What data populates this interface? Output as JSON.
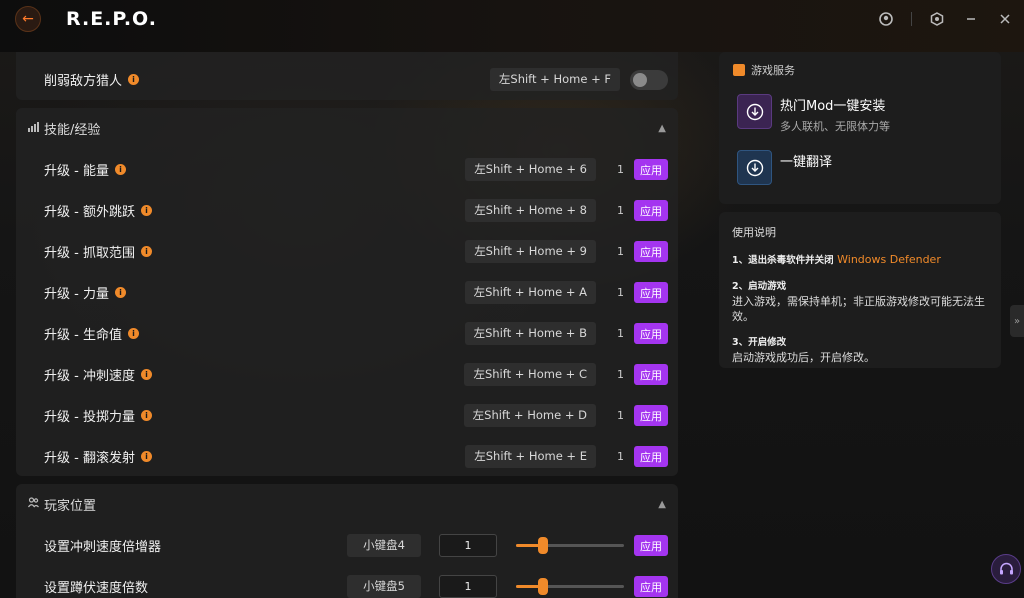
{
  "app": {
    "title": "R.E.P.O."
  },
  "top_row": {
    "label": "削弱敌方猎人",
    "hotkey": "左Shift + Home + F"
  },
  "skills": {
    "title": "技能/经验",
    "items": [
      {
        "label": "升级 - 能量",
        "hotkey": "左Shift + Home + 6",
        "value": "1",
        "apply": "应用"
      },
      {
        "label": "升级 - 额外跳跃",
        "hotkey": "左Shift + Home + 8",
        "value": "1",
        "apply": "应用"
      },
      {
        "label": "升级 - 抓取范围",
        "hotkey": "左Shift + Home + 9",
        "value": "1",
        "apply": "应用"
      },
      {
        "label": "升级 - 力量",
        "hotkey": "左Shift + Home + A",
        "value": "1",
        "apply": "应用"
      },
      {
        "label": "升级 - 生命值",
        "hotkey": "左Shift + Home + B",
        "value": "1",
        "apply": "应用"
      },
      {
        "label": "升级 - 冲刺速度",
        "hotkey": "左Shift + Home + C",
        "value": "1",
        "apply": "应用"
      },
      {
        "label": "升级 - 投掷力量",
        "hotkey": "左Shift + Home + D",
        "value": "1",
        "apply": "应用"
      },
      {
        "label": "升级 - 翻滚发射",
        "hotkey": "左Shift + Home + E",
        "value": "1",
        "apply": "应用"
      }
    ]
  },
  "player_pos": {
    "title": "玩家位置",
    "items": [
      {
        "label": "设置冲刺速度倍增器",
        "hotkey": "小键盘4",
        "value": "1",
        "slider_fraction": 0.25,
        "apply": "应用"
      },
      {
        "label": "设置蹲伏速度倍数",
        "hotkey": "小键盘5",
        "value": "1",
        "slider_fraction": 0.25,
        "apply": "应用"
      }
    ]
  },
  "services": {
    "title": "游戏服务",
    "items": [
      {
        "name": "热门Mod一键安装",
        "sub": "多人联机、无限体力等"
      },
      {
        "name": "一键翻译",
        "sub": ""
      }
    ]
  },
  "guide": {
    "title": "使用说明",
    "step1_title": "1、退出杀毒软件并关闭",
    "step1_link": "Windows Defender",
    "step2_title": "2、启动游戏",
    "step2_text": "进入游戏，需保持单机；非正版游戏修改可能无法生效。",
    "step3_title": "3、开启修改",
    "step3_text": "启动游戏成功后，开启修改。"
  },
  "colors": {
    "accent": "#a435f0",
    "orange": "#f08a2a"
  },
  "icons": {
    "back": "back-arrow-icon",
    "info": "info-icon",
    "download": "download-icon",
    "support": "headset-icon"
  }
}
